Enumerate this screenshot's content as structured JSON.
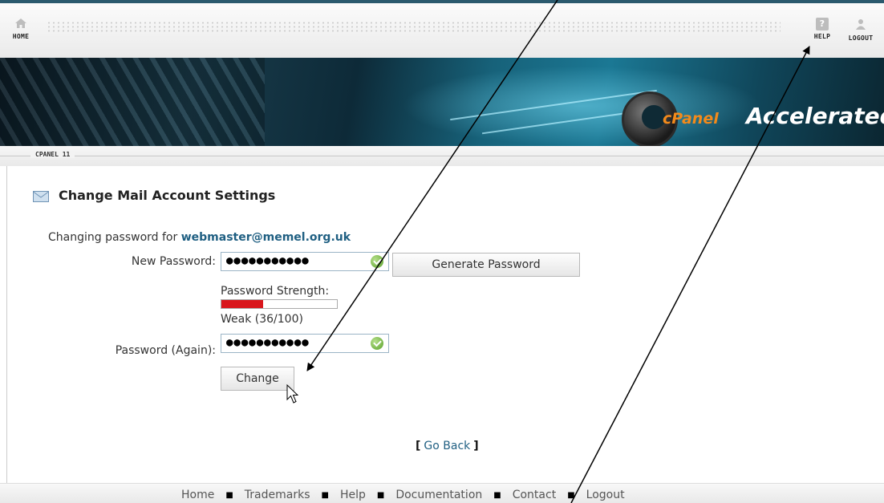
{
  "toolbar": {
    "home_label": "HOME",
    "help_label": "HELP",
    "help_glyph": "?",
    "logout_label": "LOGOUT"
  },
  "banner": {
    "brand_cpanel": "cPanel",
    "brand_accelerated": "Accelerated"
  },
  "version_label": "CPANEL 11",
  "page": {
    "title": "Change Mail Account Settings",
    "changing_prefix": "Changing password for ",
    "email": "webmaster@memel.org.uk"
  },
  "form": {
    "new_password_label": "New Password:",
    "new_password_masked": "●●●●●●●●●●●",
    "generate_button": "Generate Password",
    "strength_label": "Password Strength:",
    "strength_value": 36,
    "strength_text": "Weak (36/100)",
    "again_label": "Password (Again):",
    "again_password_masked": "●●●●●●●●●●●",
    "change_button": "Change"
  },
  "go_back": {
    "open": "[",
    "label": "Go Back",
    "close": "]"
  },
  "footer": {
    "links": [
      "Home",
      "Trademarks",
      "Help",
      "Documentation",
      "Contact",
      "Logout"
    ]
  },
  "colors": {
    "strength_fill": "#d9161c",
    "link": "#1f5f82",
    "brand_orange": "#f28a1b"
  },
  "icons": {
    "home": "home-icon",
    "help": "help-icon",
    "logout": "logout-icon",
    "mail": "mail-icon",
    "valid": "check-icon",
    "cursor": "mouse-pointer-icon"
  }
}
